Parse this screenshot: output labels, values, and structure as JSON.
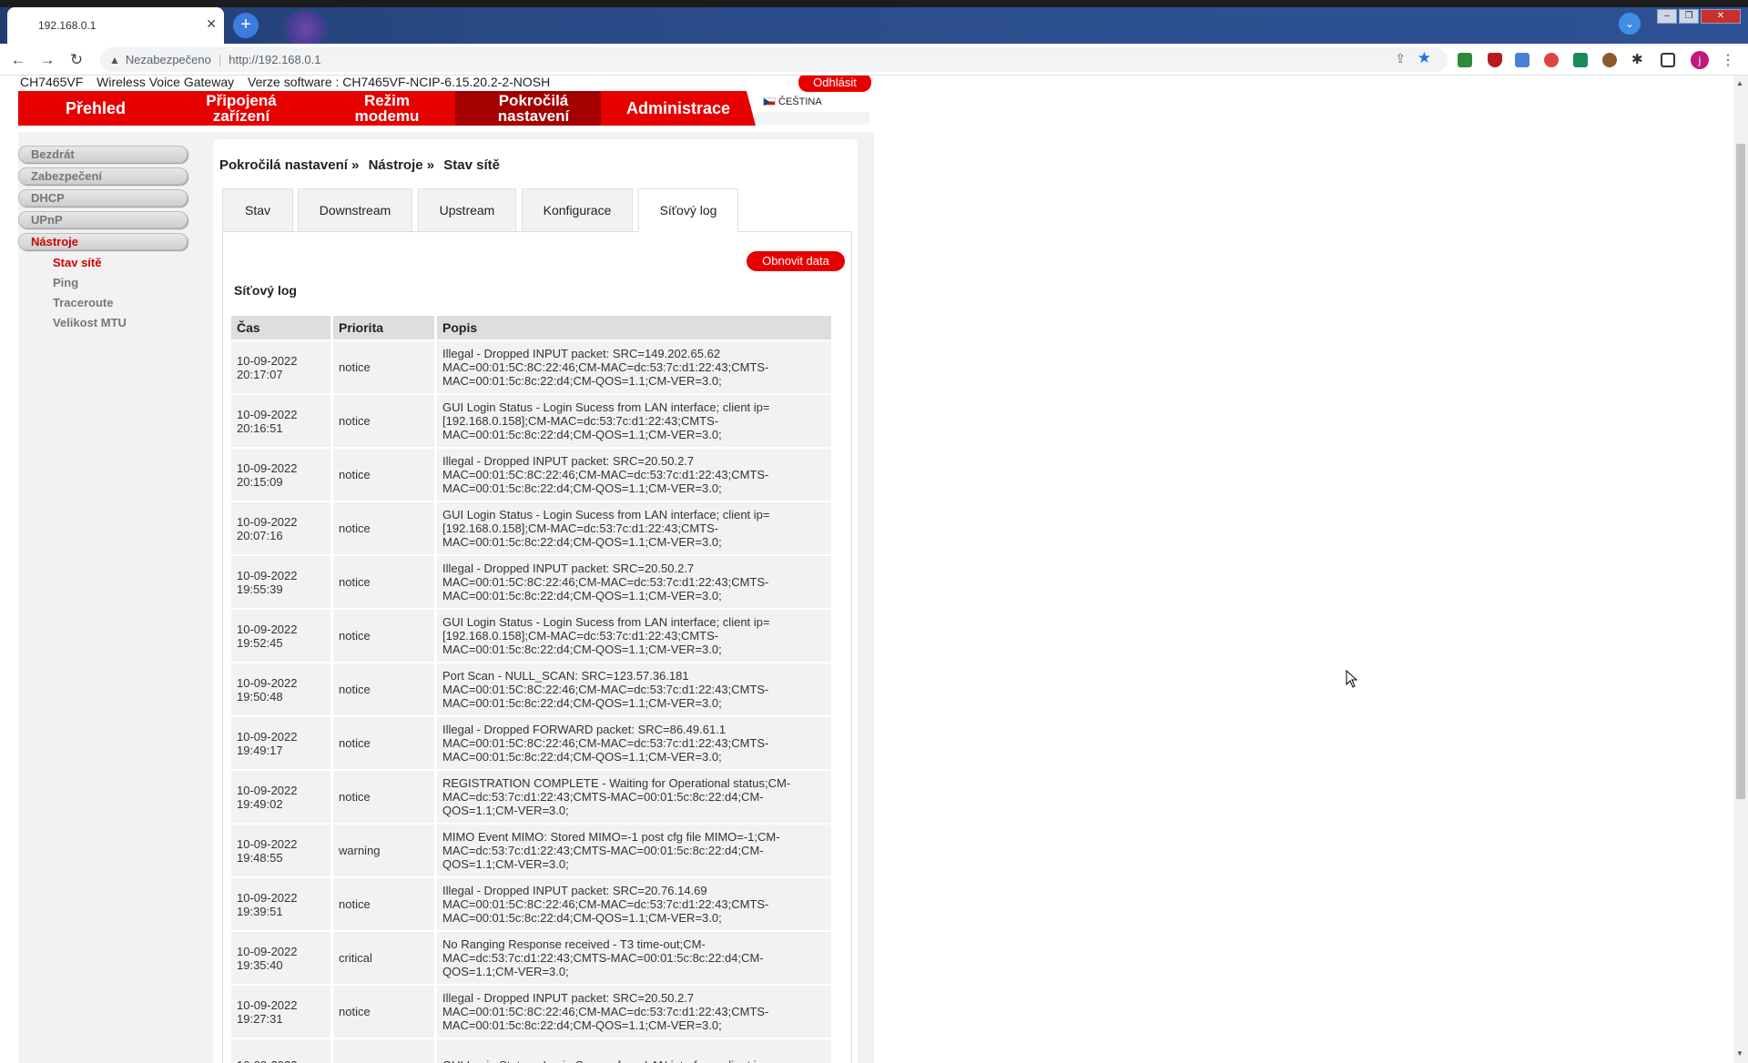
{
  "browser": {
    "tab_title": "192.168.0.1",
    "tab_close": "✕",
    "new_tab": "+",
    "security_label": "Nezabezpečeno",
    "url": "http://192.168.0.1",
    "avatar_letter": "j"
  },
  "header": {
    "model": "CH7465VF",
    "product": "Wireless Voice Gateway",
    "software": "Verze software : CH7465VF-NCIP-6.15.20.2-2-NOSH",
    "logout": "Odhlásit",
    "language": "ČEŠTINA"
  },
  "mainnav": [
    {
      "label": "Přehled"
    },
    {
      "label": "Připojená zařízení"
    },
    {
      "label": "Režim modemu"
    },
    {
      "label": "Pokročilá nastavení",
      "active": true
    },
    {
      "label": "Administrace"
    }
  ],
  "sidebar": {
    "items": [
      {
        "label": "Bezdrát"
      },
      {
        "label": "Zabezpečení"
      },
      {
        "label": "DHCP"
      },
      {
        "label": "UPnP"
      },
      {
        "label": "Nástroje",
        "active": true
      }
    ],
    "subitems": [
      {
        "label": "Stav sítě",
        "active": true
      },
      {
        "label": "Ping"
      },
      {
        "label": "Traceroute"
      },
      {
        "label": "Velikost MTU"
      }
    ]
  },
  "breadcrumb": [
    "Pokročilá nastavení »",
    "Nástroje »",
    "Stav sítě"
  ],
  "subtabs": [
    {
      "label": "Stav"
    },
    {
      "label": "Downstream"
    },
    {
      "label": "Upstream"
    },
    {
      "label": "Konfigurace"
    },
    {
      "label": "Síťový log",
      "active": true
    }
  ],
  "refresh_button": "Obnovit data",
  "log_title": "Síťový log",
  "log_table": {
    "columns": [
      "Čas",
      "Priorita",
      "Popis"
    ],
    "rows": [
      {
        "time": "10-09-2022 20:17:07",
        "priority": "notice",
        "desc": "Illegal - Dropped INPUT packet: SRC=149.202.65.62 MAC=00:01:5C:8C:22:46;CM-MAC=dc:53:7c:d1:22:43;CMTS-MAC=00:01:5c:8c:22:d4;CM-QOS=1.1;CM-VER=3.0;"
      },
      {
        "time": "10-09-2022 20:16:51",
        "priority": "notice",
        "desc": "GUI Login Status - Login Sucess from LAN interface; client ip=[192.168.0.158];CM-MAC=dc:53:7c:d1:22:43;CMTS-MAC=00:01:5c:8c:22:d4;CM-QOS=1.1;CM-VER=3.0;"
      },
      {
        "time": "10-09-2022 20:15:09",
        "priority": "notice",
        "desc": "Illegal - Dropped INPUT packet: SRC=20.50.2.7 MAC=00:01:5C:8C:22:46;CM-MAC=dc:53:7c:d1:22:43;CMTS-MAC=00:01:5c:8c:22:d4;CM-QOS=1.1;CM-VER=3.0;"
      },
      {
        "time": "10-09-2022 20:07:16",
        "priority": "notice",
        "desc": "GUI Login Status - Login Sucess from LAN interface; client ip=[192.168.0.158];CM-MAC=dc:53:7c:d1:22:43;CMTS-MAC=00:01:5c:8c:22:d4;CM-QOS=1.1;CM-VER=3.0;"
      },
      {
        "time": "10-09-2022 19:55:39",
        "priority": "notice",
        "desc": "Illegal - Dropped INPUT packet: SRC=20.50.2.7 MAC=00:01:5C:8C:22:46;CM-MAC=dc:53:7c:d1:22:43;CMTS-MAC=00:01:5c:8c:22:d4;CM-QOS=1.1;CM-VER=3.0;"
      },
      {
        "time": "10-09-2022 19:52:45",
        "priority": "notice",
        "desc": "GUI Login Status - Login Sucess from LAN interface; client ip=[192.168.0.158];CM-MAC=dc:53:7c:d1:22:43;CMTS-MAC=00:01:5c:8c:22:d4;CM-QOS=1.1;CM-VER=3.0;"
      },
      {
        "time": "10-09-2022 19:50:48",
        "priority": "notice",
        "desc": "Port Scan - NULL_SCAN: SRC=123.57.36.181 MAC=00:01:5C:8C:22:46;CM-MAC=dc:53:7c:d1:22:43;CMTS-MAC=00:01:5c:8c:22:d4;CM-QOS=1.1;CM-VER=3.0;"
      },
      {
        "time": "10-09-2022 19:49:17",
        "priority": "notice",
        "desc": "Illegal - Dropped FORWARD packet: SRC=86.49.61.1 MAC=00:01:5C:8C:22:46;CM-MAC=dc:53:7c:d1:22:43;CMTS-MAC=00:01:5c:8c:22:d4;CM-QOS=1.1;CM-VER=3.0;"
      },
      {
        "time": "10-09-2022 19:49:02",
        "priority": "notice",
        "desc": "REGISTRATION COMPLETE - Waiting for Operational status;CM-MAC=dc:53:7c:d1:22:43;CMTS-MAC=00:01:5c:8c:22:d4;CM-QOS=1.1;CM-VER=3.0;"
      },
      {
        "time": "10-09-2022 19:48:55",
        "priority": "warning",
        "desc": "MIMO Event MIMO: Stored MIMO=-1 post cfg file MIMO=-1;CM-MAC=dc:53:7c:d1:22:43;CMTS-MAC=00:01:5c:8c:22:d4;CM-QOS=1.1;CM-VER=3.0;"
      },
      {
        "time": "10-09-2022 19:39:51",
        "priority": "notice",
        "desc": "Illegal - Dropped INPUT packet: SRC=20.76.14.69 MAC=00:01:5C:8C:22:46;CM-MAC=dc:53:7c:d1:22:43;CMTS-MAC=00:01:5c:8c:22:d4;CM-QOS=1.1;CM-VER=3.0;"
      },
      {
        "time": "10-09-2022 19:35:40",
        "priority": "critical",
        "desc": "No Ranging Response received - T3 time-out;CM-MAC=dc:53:7c:d1:22:43;CMTS-MAC=00:01:5c:8c:22:d4;CM-QOS=1.1;CM-VER=3.0;"
      },
      {
        "time": "10-09-2022 19:27:31",
        "priority": "notice",
        "desc": "Illegal - Dropped INPUT packet: SRC=20.50.2.7 MAC=00:01:5C:8C:22:46;CM-MAC=dc:53:7c:d1:22:43;CMTS-MAC=00:01:5c:8c:22:d4;CM-QOS=1.1;CM-VER=3.0;"
      },
      {
        "time": "10-09-2022",
        "priority": "",
        "desc": "GUI Login Status - Login Sucess from LAN interface; client ip="
      }
    ]
  },
  "colors": {
    "brand_red": "#e60000",
    "active_tab_red": "#a50000"
  }
}
